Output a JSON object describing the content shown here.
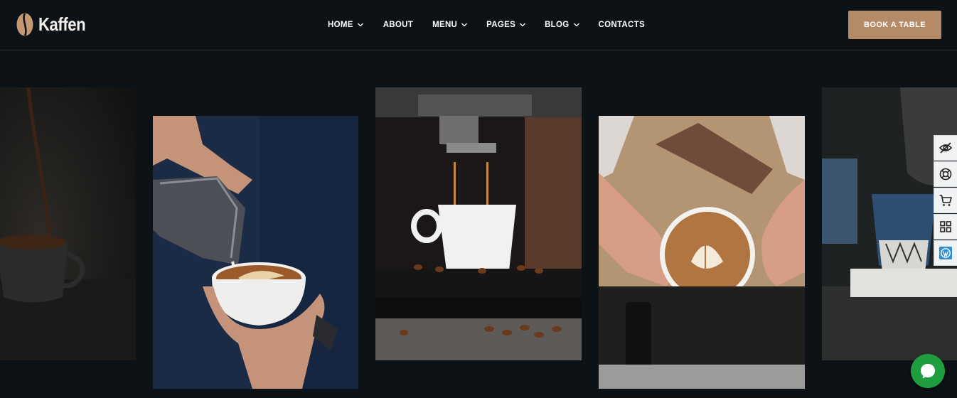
{
  "brand": {
    "name": "Kaffen",
    "logo_icon": "coffee-bean-icon"
  },
  "nav": {
    "items": [
      {
        "label": "HOME",
        "has_dropdown": true
      },
      {
        "label": "ABOUT",
        "has_dropdown": false
      },
      {
        "label": "MENU",
        "has_dropdown": true
      },
      {
        "label": "PAGES",
        "has_dropdown": true
      },
      {
        "label": "BLOG",
        "has_dropdown": true
      },
      {
        "label": "CONTACTS",
        "has_dropdown": false
      }
    ]
  },
  "cta": {
    "label": "BOOK A TABLE"
  },
  "gallery": {
    "images": [
      {
        "subject": "coffee-pouring-into-dark-cup"
      },
      {
        "subject": "barista-pouring-latte-art"
      },
      {
        "subject": "espresso-machine-extraction"
      },
      {
        "subject": "barista-holding-latte"
      },
      {
        "subject": "pour-over-coffee-blue-cup"
      }
    ]
  },
  "side_tools": [
    {
      "icon": "eye-off-icon"
    },
    {
      "icon": "lifebuoy-icon"
    },
    {
      "icon": "cart-icon"
    },
    {
      "icon": "grid-icon"
    },
    {
      "icon": "wordpress-icon"
    }
  ],
  "chat": {
    "icon": "chat-bubble-icon"
  },
  "colors": {
    "background": "#0c1216",
    "accent": "#b58a67",
    "chat": "#1f9e3f"
  }
}
